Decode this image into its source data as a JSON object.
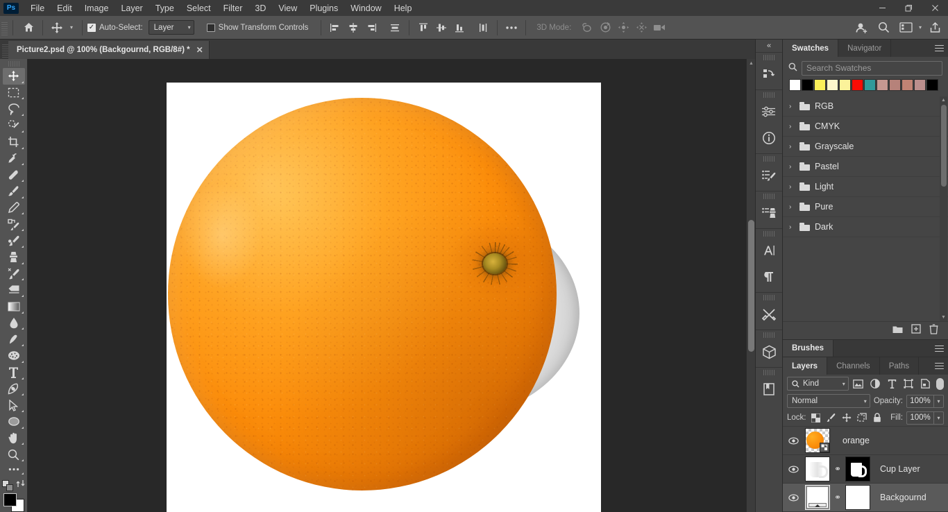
{
  "app": {
    "logo": "Ps",
    "menus": [
      "File",
      "Edit",
      "Image",
      "Layer",
      "Type",
      "Select",
      "Filter",
      "3D",
      "View",
      "Plugins",
      "Window",
      "Help"
    ],
    "window_controls": {
      "minimize": "—",
      "restore": "❐",
      "close": "✕"
    }
  },
  "options_bar": {
    "home_icon": "home-icon",
    "tool_icon": "move-tool-icon",
    "auto_select_label": "Auto-Select:",
    "auto_select_checked": true,
    "auto_select_scope": "Layer",
    "show_transform_label": "Show Transform Controls",
    "show_transform_checked": false,
    "align_icons": [
      "align-left-edges-icon",
      "align-horizontal-centers-icon",
      "align-right-edges-icon",
      "distribute-horizontally-icon"
    ],
    "align_icons2": [
      "align-top-edges-icon",
      "align-vertical-centers-icon",
      "align-bottom-edges-icon",
      "distribute-vertically-icon"
    ],
    "more_icon": "more-options-icon",
    "mode_3d_label": "3D Mode:",
    "mode_3d_icons": [
      "orbit-3d-icon",
      "roll-3d-icon",
      "pan-3d-icon",
      "slide-3d-icon",
      "camera-3d-icon"
    ],
    "right_icons": [
      "add-collaborator-icon",
      "search-icon",
      "workspace-icon",
      "workspace-chevron-icon",
      "share-icon"
    ]
  },
  "document": {
    "tab_title": "Picture2.psd @ 100% (Backgournd, RGB/8#) *",
    "close_glyph": "✕",
    "zoom": "100%",
    "color_mode": "RGB/8#",
    "active_layer_name": "Backgournd",
    "unsaved": true
  },
  "toolbar": {
    "tools": [
      {
        "name": "move-tool",
        "label": "Move Tool",
        "active": true
      },
      {
        "name": "rectangular-marquee-tool",
        "label": "Rectangular Marquee Tool",
        "active": false
      },
      {
        "name": "lasso-tool",
        "label": "Lasso Tool",
        "active": false
      },
      {
        "name": "object-selection-tool",
        "label": "Object Selection Tool",
        "active": false
      },
      {
        "name": "crop-tool",
        "label": "Crop Tool",
        "active": false
      },
      {
        "name": "eyedropper-tool",
        "label": "Eyedropper Tool",
        "active": false
      },
      {
        "name": "healing-brush-tool",
        "label": "Spot Healing Brush Tool",
        "active": false
      },
      {
        "name": "brush-tool",
        "label": "Brush Tool",
        "active": false
      },
      {
        "name": "clone-stamp-tool",
        "label": "Clone Stamp Tool",
        "active": false
      },
      {
        "name": "history-brush-tool",
        "label": "History Brush Tool",
        "active": false
      },
      {
        "name": "eraser-tool",
        "label": "Eraser Tool",
        "active": false
      },
      {
        "name": "gradient-tool",
        "label": "Gradient Tool",
        "active": false
      },
      {
        "name": "blur-tool",
        "label": "Blur Tool",
        "active": false
      },
      {
        "name": "dodge-tool",
        "label": "Dodge Tool",
        "active": false
      },
      {
        "name": "sponge-tool",
        "label": "Sponge Tool",
        "active": false
      },
      {
        "name": "type-tool",
        "label": "Horizontal Type Tool",
        "active": false
      },
      {
        "name": "pen-tool",
        "label": "Pen Tool",
        "active": false
      },
      {
        "name": "path-selection-tool",
        "label": "Path Selection Tool",
        "active": false
      },
      {
        "name": "ellipse-tool",
        "label": "Ellipse Tool",
        "active": false
      },
      {
        "name": "hand-tool",
        "label": "Hand Tool",
        "active": false
      },
      {
        "name": "zoom-tool",
        "label": "Zoom Tool",
        "active": false
      },
      {
        "name": "edit-toolbar",
        "label": "Edit Toolbar",
        "active": false
      }
    ],
    "foreground_color": "#000000",
    "background_color": "#ffffff",
    "swap_icon": "swap-colors-icon",
    "default_colors_icon": "default-colors-icon"
  },
  "rail": {
    "collapse_glyph": "«",
    "icons": [
      "history-icon",
      "adjustments-icon",
      "info-icon",
      "brush-settings-icon",
      "clone-source-icon",
      "character-icon",
      "paragraph-icon",
      "tool-presets-icon",
      "3d-icon",
      "libraries-icon"
    ]
  },
  "swatches_panel": {
    "tabs": [
      {
        "label": "Swatches",
        "active": true
      },
      {
        "label": "Navigator",
        "active": false
      }
    ],
    "menu_icon": "panel-menu-icon",
    "search_placeholder": "Search Swatches",
    "search_value": "",
    "search_icon": "search-icon",
    "recent_colors": [
      "#ffffff",
      "#000000",
      "#fbf05a",
      "#fdf7cc",
      "#fbf29a",
      "#fb0c05",
      "#309a9a",
      "#c59891",
      "#b6827a",
      "#c08374",
      "#bb8f8d",
      "#000000"
    ],
    "groups": [
      {
        "label": "RGB",
        "icon": "folder-icon",
        "expanded": false
      },
      {
        "label": "CMYK",
        "icon": "folder-icon",
        "expanded": false
      },
      {
        "label": "Grayscale",
        "icon": "folder-icon",
        "expanded": false
      },
      {
        "label": "Pastel",
        "icon": "folder-icon",
        "expanded": false
      },
      {
        "label": "Light",
        "icon": "folder-icon",
        "expanded": false
      },
      {
        "label": "Pure",
        "icon": "folder-icon",
        "expanded": false
      },
      {
        "label": "Dark",
        "icon": "folder-icon",
        "expanded": false
      }
    ],
    "footer_icons": [
      "new-group-icon",
      "new-swatch-icon",
      "delete-swatch-icon"
    ]
  },
  "brushes_panel": {
    "tabs": [
      {
        "label": "Brushes",
        "active": true
      }
    ],
    "menu_icon": "panel-menu-icon"
  },
  "layers_panel": {
    "tabs": [
      {
        "label": "Layers",
        "active": true
      },
      {
        "label": "Channels",
        "active": false
      },
      {
        "label": "Paths",
        "active": false
      }
    ],
    "menu_icon": "panel-menu-icon",
    "filter_kind_label": "Kind",
    "filter_icons": [
      "filter-pixel-icon",
      "filter-adjustment-icon",
      "filter-type-icon",
      "filter-shape-icon",
      "filter-smart-object-icon"
    ],
    "filter_toggle": "filter-enable-toggle",
    "blend_mode": "Normal",
    "opacity_label": "Opacity:",
    "opacity_value": "100%",
    "lock_label": "Lock:",
    "lock_icons": [
      "lock-transparent-pixels-icon",
      "lock-image-pixels-icon",
      "lock-position-icon",
      "lock-artboard-nesting-icon",
      "lock-all-icon"
    ],
    "fill_label": "Fill:",
    "fill_value": "100%",
    "layers": [
      {
        "name": "orange",
        "visible": true,
        "selected": false,
        "kind": "smart-object",
        "has_mask": false,
        "linked": false
      },
      {
        "name": "Cup Layer",
        "visible": true,
        "selected": false,
        "kind": "pixel",
        "has_mask": true,
        "linked": true
      },
      {
        "name": "Backgournd",
        "visible": true,
        "selected": true,
        "kind": "pixel",
        "has_mask": true,
        "linked": true
      }
    ],
    "eye_glyph": "◉",
    "link_glyph": "⚭"
  },
  "canvas": {
    "background_color": "#282828",
    "artboard_color": "#ffffff",
    "subject": "orange-fruit-on-white-cup",
    "scrollbar": {
      "up_glyph": "▲",
      "down_glyph": "▼"
    }
  }
}
